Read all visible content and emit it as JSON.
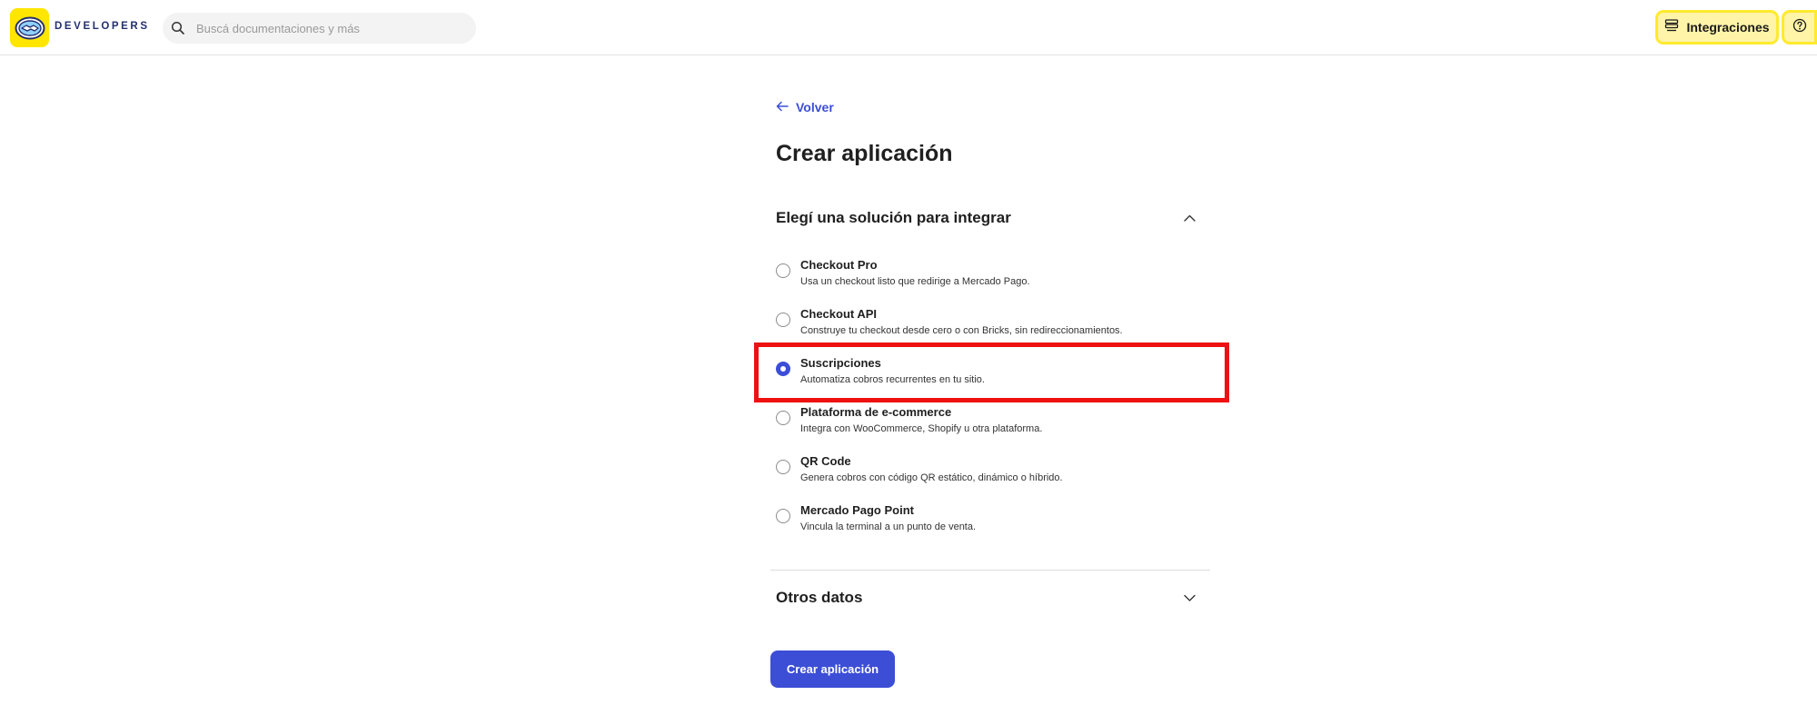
{
  "header": {
    "brand": "DEVELOPERS",
    "logo_icon": "handshake-logo",
    "search_placeholder": "Buscá documentaciones y más",
    "integraciones_label": "Integraciones",
    "help_icon": "question-icon"
  },
  "main": {
    "back_label": "Volver",
    "page_title": "Crear aplicación",
    "solution_section": {
      "label": "Elegí una solución para integrar",
      "expanded": true
    },
    "options": [
      {
        "title": "Checkout Pro",
        "desc": "Usa un checkout listo que redirige a Mercado Pago.",
        "checked": false
      },
      {
        "title": "Checkout API",
        "desc": "Construye tu checkout desde cero o con Bricks, sin redireccionamientos.",
        "checked": false
      },
      {
        "title": "Suscripciones",
        "desc": "Automatiza cobros recurrentes en tu sitio.",
        "checked": true
      },
      {
        "title": "Plataforma de e-commerce",
        "desc": "Integra con WooCommerce, Shopify u otra plataforma.",
        "checked": false
      },
      {
        "title": "QR Code",
        "desc": "Genera cobros con código QR estático, dinámico o híbrido.",
        "checked": false
      },
      {
        "title": "Mercado Pago Point",
        "desc": "Vincula la terminal a un punto de venta.",
        "checked": false
      }
    ],
    "other_section": {
      "label": "Otros datos",
      "expanded": false
    },
    "create_button_label": "Crear aplicación"
  },
  "colors": {
    "accent": "#3c4ed6",
    "brand_yellow": "#ffe600",
    "highlight_red": "#ee1111"
  }
}
